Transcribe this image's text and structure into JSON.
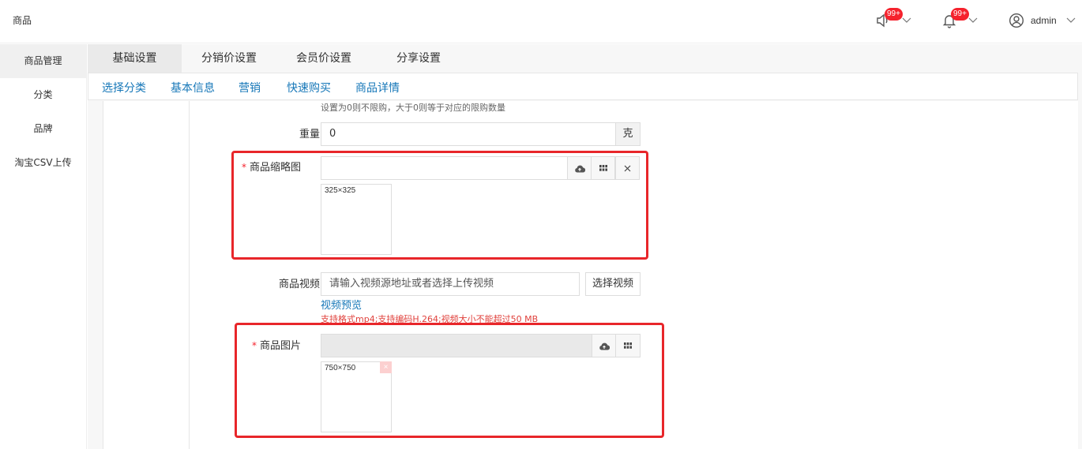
{
  "app": {
    "title": "商品"
  },
  "header": {
    "speaker_badge": "99+",
    "bell_badge": "99+",
    "user_name": "admin"
  },
  "sidebar": {
    "items": [
      {
        "label": "商品管理"
      },
      {
        "label": "分类"
      },
      {
        "label": "品牌"
      },
      {
        "label": "淘宝CSV上传"
      }
    ]
  },
  "tabs": [
    {
      "label": "基础设置"
    },
    {
      "label": "分销价设置"
    },
    {
      "label": "会员价设置"
    },
    {
      "label": "分享设置"
    }
  ],
  "subtabs": [
    {
      "label": "选择分类"
    },
    {
      "label": "基本信息"
    },
    {
      "label": "营销"
    },
    {
      "label": "快速购买"
    },
    {
      "label": "商品详情"
    }
  ],
  "form": {
    "limit_hint": "设置为0则不限购，大于0则等于对应的限购数量",
    "weight": {
      "label": "重量",
      "value": "0",
      "unit": "克"
    },
    "thumbnail": {
      "label": "商品缩略图",
      "required": "*",
      "value": "",
      "size_hint": "325×325"
    },
    "video": {
      "label": "商品视频",
      "placeholder": "请输入视频源地址或者选择上传视频",
      "select_button": "选择视频",
      "preview_link": "视频预览",
      "support_hint": "支持格式mp4;支持编码H.264;视频大小不能超过50 MB"
    },
    "images": {
      "label": "商品图片",
      "required": "*",
      "size_hint": "750×750",
      "delete_icon": "×"
    }
  },
  "colors": {
    "accent": "#1677b8",
    "danger": "#e8262a",
    "badge": "#f5222d"
  }
}
